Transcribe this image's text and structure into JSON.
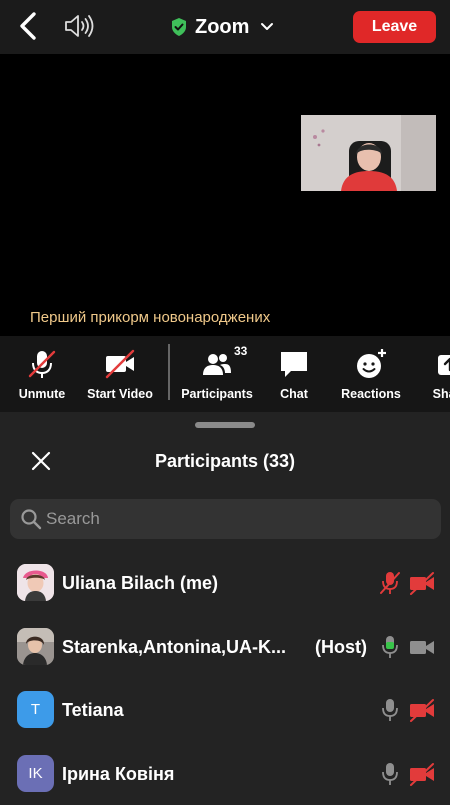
{
  "header": {
    "title": "Zoom",
    "leave_label": "Leave",
    "icons": [
      "back-chevron-icon",
      "speaker-icon",
      "shield-check-icon",
      "chevron-down-icon"
    ]
  },
  "meeting": {
    "caption": "Перший прикорм новонароджених"
  },
  "toolbar": {
    "unmute": "Unmute",
    "start_video": "Start Video",
    "participants": "Participants",
    "participants_count": "33",
    "chat": "Chat",
    "reactions": "Reactions",
    "share": "Share"
  },
  "panel": {
    "title": "Participants (33)",
    "search_placeholder": "Search",
    "participants": [
      {
        "name": "Uliana Bilach (me)",
        "host_tag": "",
        "avatar": "photo",
        "mic": "muted-red",
        "video": "off-red"
      },
      {
        "name": "Starenka,Antonina,UA-K...",
        "host_tag": "(Host)",
        "avatar": "photo",
        "mic": "on-green",
        "video": "on-gray"
      },
      {
        "name": "Tetiana",
        "host_tag": "",
        "avatar_letter": "T",
        "avatar_color": "#3d9be9",
        "mic": "muted-gray",
        "video": "off-red"
      },
      {
        "name": "Ірина Ковіня",
        "host_tag": "",
        "avatar_letter": "IK",
        "avatar_color": "#6b6fb5",
        "mic": "muted-gray",
        "video": "off-red"
      }
    ]
  },
  "colors": {
    "leave": "#e02828",
    "caption": "#f0c98a",
    "shield": "#3fbf5a",
    "mic_active": "#39c54a",
    "muted_red": "#e23b3b"
  }
}
